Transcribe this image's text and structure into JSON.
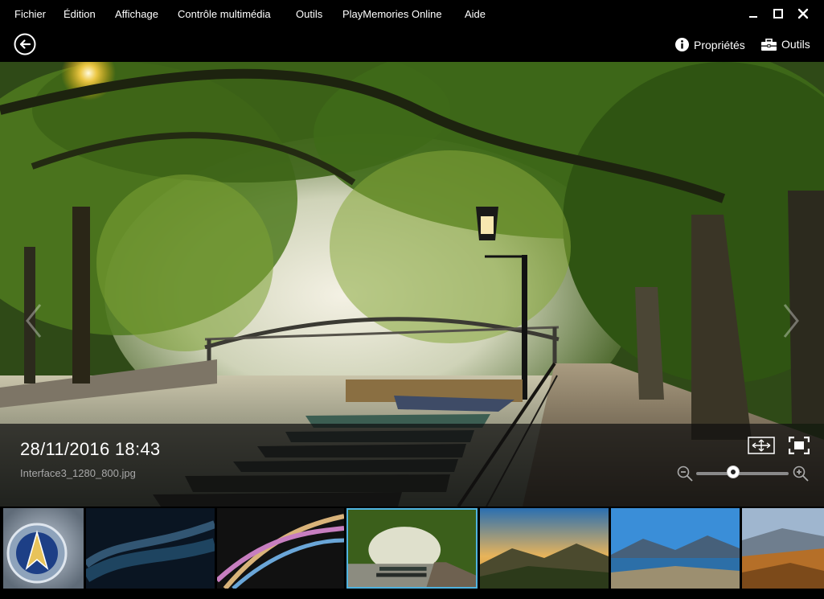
{
  "menu": {
    "items": [
      "Fichier",
      "Édition",
      "Affichage",
      "Contrôle multimédia",
      "Outils",
      "PlayMemories Online",
      "Aide"
    ]
  },
  "window_controls": {
    "minimize_icon": "minimize-icon",
    "maximize_icon": "maximize-icon",
    "close_icon": "close-icon"
  },
  "toolbar": {
    "back_icon": "back-arrow-icon",
    "properties_label": "Propriétés",
    "properties_icon": "info-icon",
    "tools_label": "Outils",
    "tools_icon": "toolbox-icon"
  },
  "viewer": {
    "date": "28/11/2016 18:43",
    "filename": "Interface3_1280_800.jpg",
    "zoom_level": 0.4,
    "icons": [
      "fit-to-window-icon",
      "fullscreen-icon",
      "zoom-out-icon",
      "zoom-in-icon",
      "previous-arrow-icon",
      "next-arrow-icon"
    ]
  },
  "filmstrip": {
    "selected_index": 3,
    "thumbnails": [
      "starfleet-emblem",
      "abstract-blue-wave",
      "abstract-light-streaks",
      "tree-lined-canal",
      "mountain-sunset",
      "lake-mountains",
      "autumn-hills"
    ]
  },
  "colors": {
    "accent": "#4fb3e0",
    "background": "#000000",
    "infobar": "#0f0f0f",
    "secondary_text": "#a8a8a8"
  }
}
